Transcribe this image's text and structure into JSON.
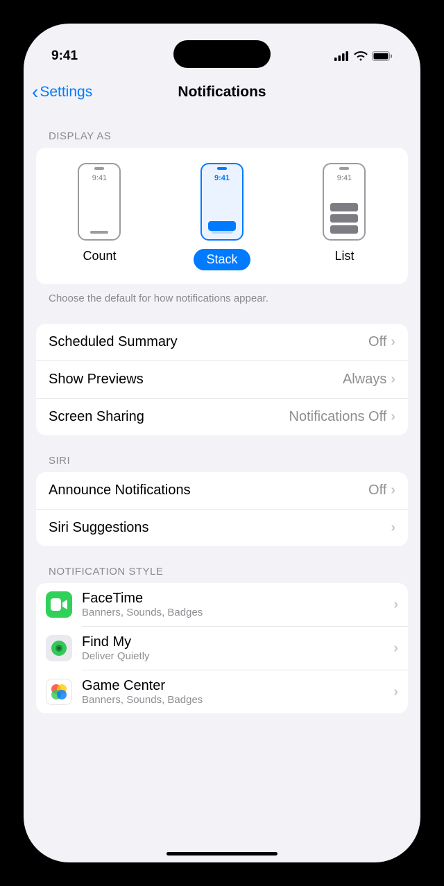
{
  "status": {
    "time": "9:41"
  },
  "nav": {
    "back": "Settings",
    "title": "Notifications"
  },
  "display_as": {
    "header": "DISPLAY AS",
    "mini_time": "9:41",
    "options": {
      "count": "Count",
      "stack": "Stack",
      "list": "List"
    },
    "selected": "stack",
    "footer": "Choose the default for how notifications appear."
  },
  "settings_group": {
    "scheduled_summary": {
      "label": "Scheduled Summary",
      "value": "Off"
    },
    "show_previews": {
      "label": "Show Previews",
      "value": "Always"
    },
    "screen_sharing": {
      "label": "Screen Sharing",
      "value": "Notifications Off"
    }
  },
  "siri": {
    "header": "SIRI",
    "announce": {
      "label": "Announce Notifications",
      "value": "Off"
    },
    "suggestions": {
      "label": "Siri Suggestions",
      "value": ""
    }
  },
  "notif_style": {
    "header": "NOTIFICATION STYLE",
    "apps": [
      {
        "name": "FaceTime",
        "detail": "Banners, Sounds, Badges",
        "icon_color": "#30d158",
        "icon": "facetime"
      },
      {
        "name": "Find My",
        "detail": "Deliver Quietly",
        "icon_color": "#34c759",
        "icon": "findmy"
      },
      {
        "name": "Game Center",
        "detail": "Banners, Sounds, Badges",
        "icon_color": "#ffffff",
        "icon": "gamecenter"
      }
    ]
  }
}
